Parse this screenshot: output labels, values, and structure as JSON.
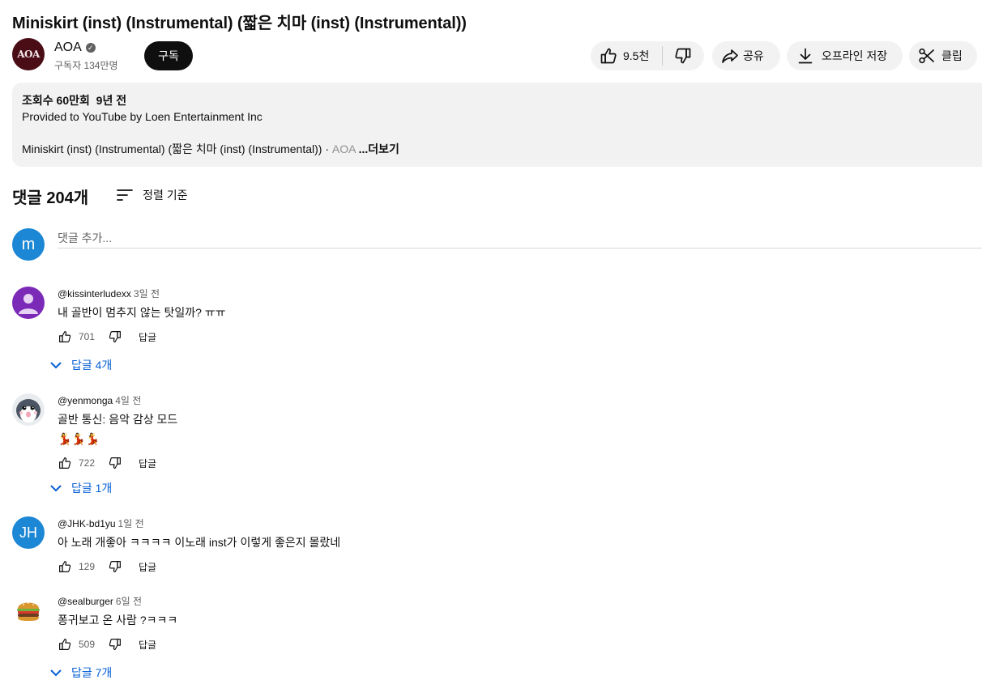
{
  "video": {
    "title": "Miniskirt (inst) (Instrumental) (짧은 치마 (inst) (Instrumental))"
  },
  "channel": {
    "avatar_text": "AOA",
    "name": "AOA",
    "verified_icon": "verified-check-icon",
    "subscribers": "구독자 134만명",
    "subscribe_label": "구독"
  },
  "actions": {
    "likes": "9.5천",
    "share_label": "공유",
    "offline_label": "오프라인 저장",
    "clip_label": "클립"
  },
  "description": {
    "views": "조회수 60만회",
    "age": "9년 전",
    "provided_by": "Provided to YouTube by Loen Entertainment Inc",
    "summary": "Miniskirt (inst) (Instrumental) (짧은 치마 (inst) (Instrumental)) · ",
    "summary_fade": "AOA",
    "more_label": "...더보기"
  },
  "comments_section": {
    "count_label": "댓글 204개",
    "sort_label": "정렬 기준",
    "my_avatar_letter": "m",
    "add_placeholder": "댓글 추가...",
    "reply_label": "답글",
    "comments": [
      {
        "author": "@kissinterludexx",
        "time": "3일 전",
        "text": "내 골반이 멈추지 않는 탓일까? ㅠㅠ",
        "likes": "701",
        "replies": "답글 4개",
        "avatar": "default-person-avatar"
      },
      {
        "author": "@yenmonga",
        "time": "4일 전",
        "text": "골반 통신: 음악 감상 모드",
        "text2": "💃💃💃",
        "likes": "722",
        "replies": "답글 1개",
        "avatar": "penguin-avatar"
      },
      {
        "author": "@JHK-bd1yu",
        "time": "1일 전",
        "text": "아 노래 개좋아 ㅋㅋㅋㅋ 이노래 inst가 이렇게 좋은지 몰랐네",
        "likes": "129",
        "avatar_text": "JH",
        "avatar": "initials-avatar"
      },
      {
        "author": "@sealburger",
        "time": "6일 전",
        "text": "퐁귀보고 온 사람 ?ㅋㅋㅋ",
        "likes": "509",
        "replies": "답글 7개",
        "avatar": "burger-avatar"
      }
    ]
  },
  "colors": {
    "link_blue": "#065fd4",
    "subscribe_bg": "#0f0f0f",
    "pill_bg": "#f2f2f2",
    "jh_avatar": "#1c87d4",
    "kiss_avatar": "#7b2ab8",
    "channel_avatar": "#4a0d16"
  }
}
